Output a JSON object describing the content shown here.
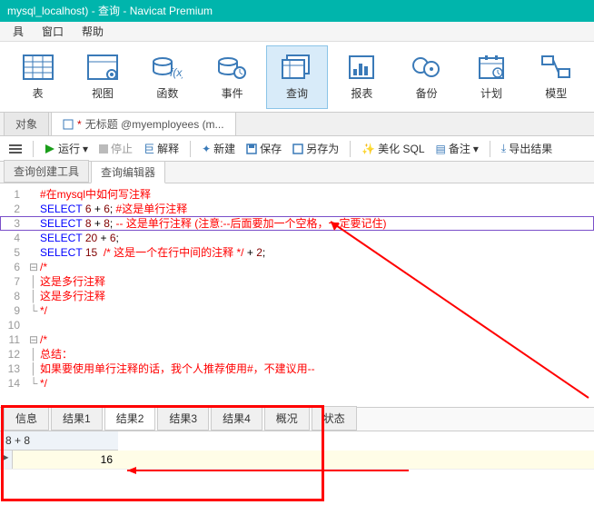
{
  "title": "mysql_localhost) - 查询 - Navicat Premium",
  "menu": {
    "m1": "具",
    "m2": "窗口",
    "m3": "帮助"
  },
  "ribbon": {
    "table": "表",
    "view": "视图",
    "func": "函数",
    "event": "事件",
    "query": "查询",
    "report": "报表",
    "backup": "备份",
    "plan": "计划",
    "model": "模型"
  },
  "tabs": {
    "obj": "对象",
    "q": "无标题 @myemployees (m..."
  },
  "toolbar": {
    "run": "运行",
    "stop": "停止",
    "explain": "解释",
    "new": "新建",
    "save": "保存",
    "saveas": "另存为",
    "beautify": "美化 SQL",
    "note": "备注",
    "export": "导出结果"
  },
  "subtabs": {
    "builder": "查询创建工具",
    "editor": "查询编辑器"
  },
  "code": {
    "l1a": "#在mysql中如何写注释",
    "l2k": "SELECT",
    "l2n1": "6",
    "l2p": " + ",
    "l2n2": "6",
    "l2s": "; ",
    "l2c": "#这是单行注释",
    "l3k": "SELECT",
    "l3n1": "8",
    "l3p": " + ",
    "l3n2": "8",
    "l3s": "; ",
    "l3c": "-- 这是单行注释 (注意:--后面要加一个空格，一定要记住)",
    "l4k": "SELECT",
    "l4n1": "20",
    "l4p": " + ",
    "l4n2": "6",
    "l4s": ";",
    "l5k": "SELECT",
    "l5n1": "15",
    "l5sp": "  ",
    "l5c": "/* 这是一个在行中间的注释 */",
    "l5p": " + ",
    "l5n2": "2",
    "l5s": ";",
    "l6": "/*",
    "l7": "这是多行注释",
    "l8": "这是多行注释",
    "l9": "*/",
    "l11": "/*",
    "l12": "总结：",
    "l13": "如果要使用单行注释的话，我个人推荐使用#，不建议用--",
    "l14": "*/"
  },
  "rtabs": {
    "info": "信息",
    "r1": "结果1",
    "r2": "结果2",
    "r3": "结果3",
    "r4": "结果4",
    "summary": "概况",
    "status": "状态"
  },
  "grid": {
    "header": "8 + 8",
    "value": "16"
  }
}
